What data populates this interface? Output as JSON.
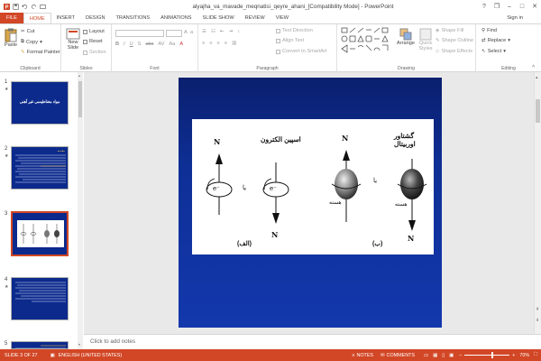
{
  "app": {
    "title": "alyajha_va_mavade_meqnatisi_qeyre_ahani_[Compatibility Mode] - PowerPoint"
  },
  "window": {
    "help": "?",
    "restore": "❐",
    "minimize": "–",
    "maximize": "□",
    "close": "✕"
  },
  "tabs": [
    "FILE",
    "HOME",
    "INSERT",
    "DESIGN",
    "TRANSITIONS",
    "ANIMATIONS",
    "SLIDE SHOW",
    "REVIEW",
    "VIEW"
  ],
  "active_tab": "HOME",
  "signin": "Sign in",
  "ribbon": {
    "clipboard": {
      "paste": "Paste",
      "cut": "Cut",
      "copy": "Copy",
      "format_painter": "Format Painter",
      "label": "Clipboard"
    },
    "slides": {
      "new_slide": "New Slide",
      "layout": "Layout",
      "reset": "Reset",
      "section": "Section",
      "label": "Slides"
    },
    "font": {
      "label": "Font"
    },
    "paragraph": {
      "text_direction": "Text Direction",
      "align_text": "Align Text",
      "convert": "Convert to SmartArt",
      "label": "Paragraph"
    },
    "drawing": {
      "arrange": "Arrange",
      "quick_styles": "Quick Styles",
      "shape_fill": "Shape Fill",
      "shape_outline": "Shape Outline",
      "shape_effects": "Shape Effects",
      "label": "Drawing"
    },
    "editing": {
      "find": "Find",
      "replace": "Replace",
      "select": "Select",
      "label": "Editing"
    }
  },
  "thumbnails": [
    {
      "num": "1",
      "title": "مواد مغناطیسی غیر آهنی"
    },
    {
      "num": "2",
      "title": "مقدمه"
    },
    {
      "num": "3",
      "title": ""
    },
    {
      "num": "4",
      "title": ""
    },
    {
      "num": "5",
      "title": ""
    }
  ],
  "slide": {
    "figure": {
      "left_caption": "اسپین الکترون",
      "right_caption": "گشتاور اوربیتال",
      "north": "N",
      "south": "S",
      "electron": "e⁻",
      "or": "یا",
      "nucleus": "هسته",
      "label_a": "(الف)",
      "label_b": "(ب)"
    }
  },
  "notes_placeholder": "Click to add notes",
  "status": {
    "slide": "SLIDE 3 OF 27",
    "language": "ENGLISH (UNITED STATES)",
    "notes": "NOTES",
    "comments": "COMMENTS",
    "zoom": "70%"
  }
}
